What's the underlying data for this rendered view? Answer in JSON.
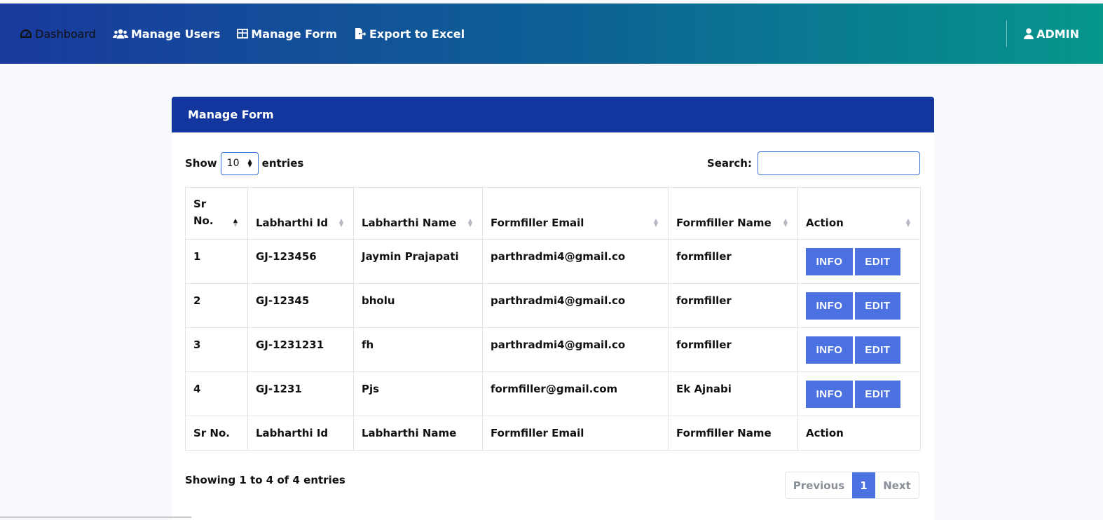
{
  "nav": {
    "items": [
      {
        "label": "Dashboard",
        "icon": "gauge-icon"
      },
      {
        "label": "Manage Users",
        "icon": "users-icon"
      },
      {
        "label": "Manage Form",
        "icon": "table-icon"
      },
      {
        "label": "Export to Excel",
        "icon": "file-export-icon"
      }
    ],
    "user": {
      "label": "ADMIN",
      "icon": "user-icon"
    }
  },
  "card": {
    "title": "Manage Form",
    "length": {
      "show": "Show",
      "value": "10",
      "entries": "entries"
    },
    "search": {
      "label": "Search:",
      "value": ""
    }
  },
  "table": {
    "headers": [
      "Sr No.",
      "Labharthi Id",
      "Labharthi Name",
      "Formfiller Email",
      "Formfiller Name",
      "Action"
    ],
    "rows": [
      {
        "sr": "1",
        "id": "GJ-123456",
        "name": "Jaymin Prajapati",
        "email": "parthradmi4@gmail.co",
        "filler": "formfiller"
      },
      {
        "sr": "2",
        "id": "GJ-12345",
        "name": "bholu",
        "email": "parthradmi4@gmail.co",
        "filler": "formfiller"
      },
      {
        "sr": "3",
        "id": "GJ-1231231",
        "name": "fh",
        "email": "parthradmi4@gmail.co",
        "filler": "formfiller"
      },
      {
        "sr": "4",
        "id": "GJ-1231",
        "name": "Pjs",
        "email": "formfiller@gmail.com",
        "filler": "Ek Ajnabi"
      }
    ],
    "actions": {
      "info": "INFO",
      "edit": "EDIT"
    }
  },
  "footer": {
    "info": "Showing 1 to 4 of 4 entries",
    "pagination": {
      "previous": "Previous",
      "page": "1",
      "next": "Next"
    }
  },
  "colors": {
    "nav_start": "#1a3a9e",
    "nav_end": "#06968c",
    "header": "#12359e",
    "button": "#4b72e0"
  }
}
